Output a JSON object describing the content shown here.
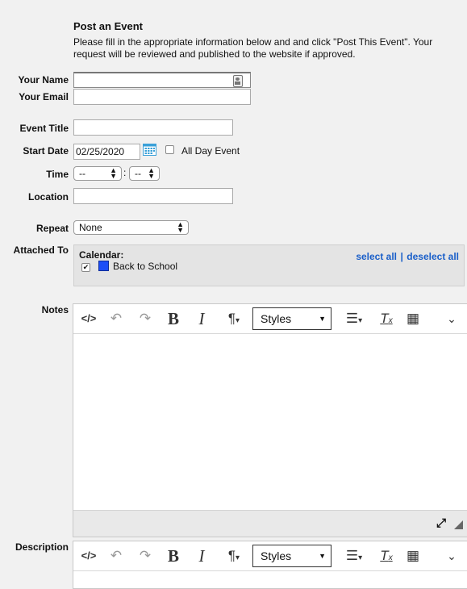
{
  "form": {
    "heading": "Post an Event",
    "intro": "Please fill in the appropriate information below and and click \"Post This Event\". Your request will be reviewed and published to the website if approved."
  },
  "fields": {
    "name_label": "Your Name",
    "email_label": "Your Email",
    "title_label": "Event Title",
    "start_label": "Start Date",
    "start_value": "02/25/2020",
    "all_day_label": "All Day Event",
    "time_label": "Time",
    "time_hour": "--",
    "time_sep": ":",
    "time_minute": "--",
    "location_label": "Location",
    "repeat_label": "Repeat",
    "repeat_value": "None",
    "attached_label": "Attached To"
  },
  "calendars": {
    "heading": "Calendar:",
    "select_all": "select all",
    "separator": "|",
    "deselect_all": "deselect all",
    "items": [
      {
        "label": "Back to School",
        "checked": true,
        "color": "#1c4ef7"
      }
    ]
  },
  "editor": {
    "notes_label": "Notes",
    "description_label": "Description",
    "styles_label": "Styles",
    "toolbar_icons": [
      "source-code-icon",
      "undo-icon",
      "redo-icon",
      "bold-icon",
      "italic-icon",
      "paragraph-icon",
      "styles-dropdown",
      "align-icon",
      "clear-format-icon",
      "table-icon",
      "expand-toolbar-icon"
    ]
  },
  "colors": {
    "link": "#1a5fc9",
    "page_bg": "#f1f1f1",
    "calendar_swatch": "#1c4ef7",
    "calendar_icon": "#3aa0d8"
  }
}
